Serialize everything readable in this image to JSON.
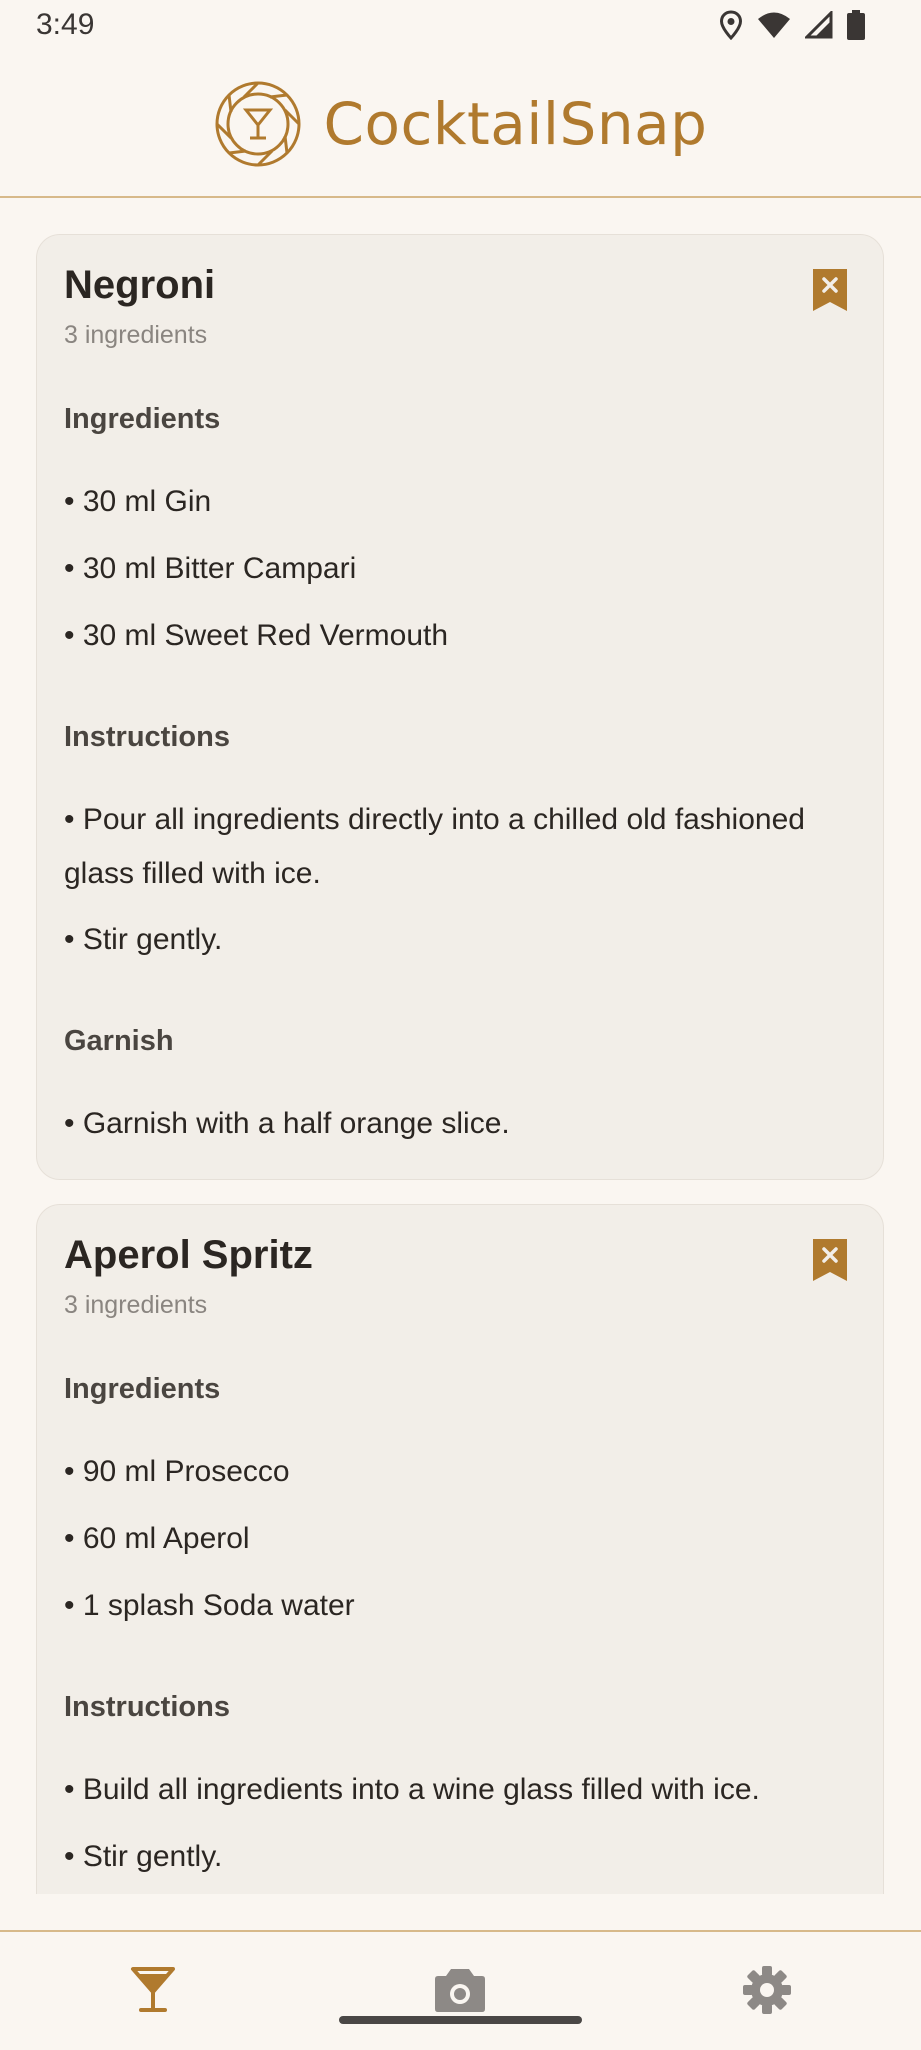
{
  "status": {
    "time": "3:49"
  },
  "app": {
    "title": "CocktailSnap",
    "accent": "#b07a2e"
  },
  "recipes": [
    {
      "name": "Negroni",
      "count": "3 ingredients",
      "ingredients_heading": "Ingredients",
      "ingredients": [
        "• 30 ml Gin",
        "• 30 ml Bitter Campari",
        "• 30 ml Sweet Red Vermouth"
      ],
      "instructions_heading": "Instructions",
      "instructions": [
        "• Pour all ingredients directly into a chilled old fashioned glass filled with ice.",
        "• Stir gently."
      ],
      "garnish_heading": "Garnish",
      "garnish": [
        "• Garnish with a half orange slice."
      ]
    },
    {
      "name": "Aperol Spritz",
      "count": "3 ingredients",
      "ingredients_heading": "Ingredients",
      "ingredients": [
        "• 90 ml Prosecco",
        "• 60 ml Aperol",
        "• 1 splash Soda water"
      ],
      "instructions_heading": "Instructions",
      "instructions": [
        "• Build all ingredients into a wine glass filled with ice.",
        "• Stir gently."
      ]
    }
  ],
  "nav": {
    "icons": [
      "cocktail-glass-icon",
      "camera-icon",
      "gear-icon"
    ],
    "active": "cocktail-glass-icon"
  }
}
